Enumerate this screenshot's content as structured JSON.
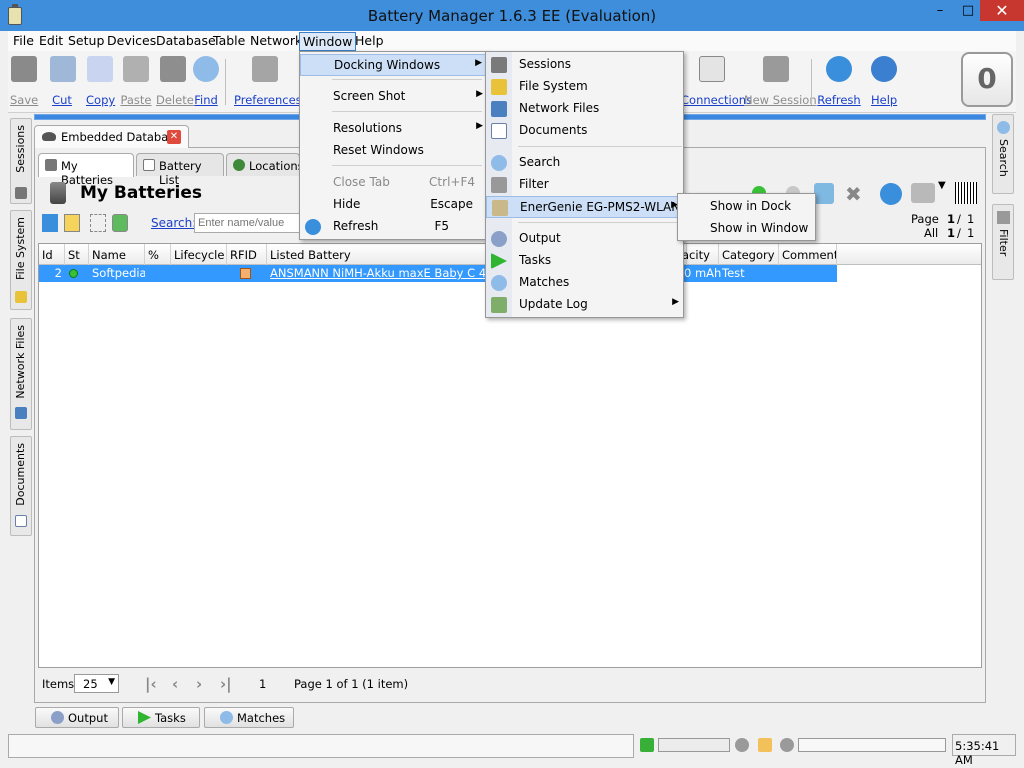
{
  "window": {
    "title": "Battery Manager 1.6.3 EE (Evaluation)",
    "minimize": "–",
    "maximize": "□",
    "close": "✕"
  },
  "menubar": [
    "File",
    "Edit",
    "Setup",
    "Devices",
    "Database",
    "Table",
    "Network",
    "Window",
    "Help"
  ],
  "toolbar": {
    "items": [
      {
        "label": "Save",
        "icon": "save-icon",
        "enabled": false
      },
      {
        "label": "Cut",
        "icon": "cut-icon",
        "enabled": true
      },
      {
        "label": "Copy",
        "icon": "copy-icon",
        "enabled": true
      },
      {
        "label": "Paste",
        "icon": "paste-icon",
        "enabled": false
      },
      {
        "label": "Delete",
        "icon": "delete-icon",
        "enabled": false
      },
      {
        "label": "Find",
        "icon": "find-icon",
        "enabled": true
      },
      {
        "label": "Preferences",
        "icon": "preferences-icon",
        "enabled": true
      },
      {
        "label": "Connections",
        "icon": "connections-icon",
        "enabled": true
      },
      {
        "label": "New Session",
        "icon": "new-session-icon",
        "enabled": false
      },
      {
        "label": "Refresh",
        "icon": "refresh-icon",
        "enabled": true
      },
      {
        "label": "Help",
        "icon": "help-icon",
        "enabled": true
      }
    ],
    "counter": "0"
  },
  "left_dock": [
    "Sessions",
    "File System",
    "Network Files",
    "Documents"
  ],
  "right_dock": [
    "Search",
    "Filter"
  ],
  "document_tab": {
    "label": "Embedded Database",
    "close": "✕"
  },
  "inner_tabs": [
    "My Batteries",
    "Battery List",
    "Locations"
  ],
  "section_title": "My Batteries",
  "search": {
    "label": "Search:",
    "placeholder": "Enter name/value"
  },
  "pager": {
    "page_label": "Page",
    "page_value": "1",
    "page_total": "1",
    "all_label": "All",
    "all_value": "1",
    "all_total": "1",
    "sep": "/"
  },
  "table": {
    "columns": [
      "Id",
      "St",
      "Name",
      "%",
      "Lifecycle",
      "RFID",
      "Listed Battery",
      "acity",
      "Category",
      "Comment"
    ],
    "rows": [
      {
        "id": "2",
        "name": "Softpedia",
        "listed": "ANSMANN NiMH-Akku maxE Baby C 4500 mA",
        "capacity": "0 mAh",
        "category": "Test"
      }
    ]
  },
  "bottom": {
    "items_label": "Items",
    "items_value": "25",
    "page_num": "1",
    "page_info": "Page 1 of 1  (1 item)"
  },
  "bottom_buttons": [
    "Output",
    "Tasks",
    "Matches"
  ],
  "statusbar": {
    "clock": "5:35:41 AM"
  },
  "window_menu": [
    {
      "label": "Docking Windows",
      "shortcut": "",
      "submenu": true,
      "highlighted": true
    },
    {
      "label": "Screen Shot",
      "shortcut": "",
      "submenu": true
    },
    {
      "label": "Resolutions",
      "shortcut": "",
      "submenu": true
    },
    {
      "label": "Reset Windows",
      "shortcut": ""
    },
    {
      "label": "Close Tab",
      "shortcut": "Ctrl+F4",
      "disabled": true
    },
    {
      "label": "Hide",
      "shortcut": "Escape"
    },
    {
      "label": "Refresh",
      "shortcut": "F5"
    }
  ],
  "docking_menu": [
    "Sessions",
    "File System",
    "Network Files",
    "Documents",
    "Search",
    "Filter",
    "EnerGenie EG-PMS2-WLAN",
    "Output",
    "Tasks",
    "Matches",
    "Update Log"
  ],
  "energenie_menu": [
    "Show in Dock",
    "Show in Window"
  ]
}
